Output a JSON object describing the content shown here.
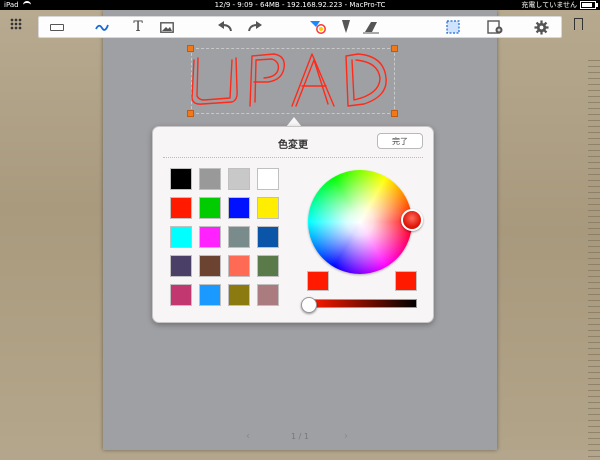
{
  "status_bar": {
    "device": "iPad",
    "center": "12/9 - 9:09 - 64MB - 192.168.92.223 - MacPro-TC",
    "charging": "充電していません"
  },
  "toolbar": {
    "icons": [
      "keyboard-icon",
      "pen-icon",
      "text-icon",
      "image-icon",
      "undo-icon",
      "redo-icon",
      "color-icon",
      "marker-icon",
      "eraser-icon",
      "select-icon",
      "insert-page-icon",
      "settings-icon"
    ]
  },
  "canvas": {
    "handwritten_text": "UPAD",
    "ink_color": "#ff2a1a"
  },
  "color_popover": {
    "title": "色変更",
    "done_label": "完了",
    "swatches": [
      [
        "#000000",
        "#999999",
        "#c8c8c8",
        "#ffffff"
      ],
      [
        "#ff1a00",
        "#00cc00",
        "#0011ff",
        "#ffee00"
      ],
      [
        "#00ffff",
        "#ff22ff",
        "#7a8b8c",
        "#0a55a8"
      ],
      [
        "#4a3f66",
        "#6b4330",
        "#ff6a55",
        "#5a7a4a"
      ],
      [
        "#c23770",
        "#1a99ff",
        "#8a7a10",
        "#aa7c80"
      ]
    ],
    "selected_color": "#ff1a00",
    "previous_color": "#ff1a00",
    "brightness": 0.0
  },
  "page_nav": {
    "label": "1 / 1"
  }
}
